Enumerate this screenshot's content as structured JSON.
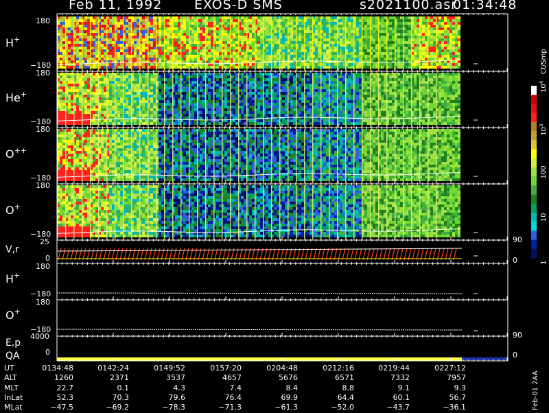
{
  "header": {
    "date": "Feb 11, 1992",
    "mission": "EXOS-D SMS",
    "file": "s2021100.asr",
    "time": "01:34:48"
  },
  "colors": {
    "background": "#000000",
    "axis": "#ffffff",
    "qa_bar": "#ffff44",
    "qa_bar_end": "#2233aa",
    "trace": "#ffffff",
    "velocity_ticks": "#ff4422"
  },
  "panels": {
    "h_plus": {
      "label": "H",
      "sup": "+",
      "ymax": "180",
      "ymin": "−180"
    },
    "he_plus": {
      "label": "He",
      "sup": "+",
      "ymax": "180",
      "ymin": "−180"
    },
    "o_pp": {
      "label": "O",
      "sup": "++",
      "ymax": "180",
      "ymin": "−180"
    },
    "o_plus": {
      "label": "O",
      "sup": "+",
      "ymax": "180",
      "ymin": "−180"
    },
    "vr": {
      "label": "V,r",
      "ymax": "25",
      "ymin": "0",
      "right_top": "90",
      "right_bottom": "0"
    },
    "h_plus2": {
      "label": "H",
      "sup": "+",
      "ymax": "180",
      "ymin": "−180"
    },
    "o_plus2": {
      "label": "O",
      "sup": "+",
      "ymax": "180",
      "ymin": "−180"
    },
    "ep": {
      "label": "E,p",
      "ymax": "4000",
      "ymin": "0",
      "right_top": "90",
      "right_bottom": "0"
    },
    "qa": {
      "label": "QA"
    }
  },
  "colorbar": {
    "unit": "Ct/Smp",
    "ticks": [
      {
        "label": "10",
        "sup": "4",
        "frac": 1.0
      },
      {
        "label": "10",
        "sup": "3",
        "frac": 0.75
      },
      {
        "label": "100",
        "sup": "",
        "frac": 0.5
      },
      {
        "label": "10",
        "sup": "",
        "frac": 0.25
      },
      {
        "label": "1",
        "sup": "",
        "frac": 0.0
      }
    ],
    "colors": [
      "#ffffff",
      "#cc0000",
      "#e41010",
      "#ff2020",
      "#b0802a",
      "#c2a030",
      "#d8c838",
      "#ffff00",
      "#d0f040",
      "#a0e040",
      "#70d830",
      "#40b040",
      "#208020",
      "#00a060",
      "#00b8b8",
      "#00d8d8",
      "#3060e0",
      "#0020a0",
      "#001060"
    ]
  },
  "table": {
    "row_labels": [
      "UT",
      "ALT",
      "MLT",
      "InLat",
      "MLat"
    ],
    "columns": [
      {
        "ut": "0134:48",
        "alt": "1260",
        "mlt": "22.7",
        "inlat": "52.3",
        "mlat": "−47.5"
      },
      {
        "ut": "0142:24",
        "alt": "2371",
        "mlt": "0.1",
        "inlat": "70.3",
        "mlat": "−69.2"
      },
      {
        "ut": "0149:52",
        "alt": "3537",
        "mlt": "4.3",
        "inlat": "79.6",
        "mlat": "−78.3"
      },
      {
        "ut": "0157:20",
        "alt": "4657",
        "mlt": "7.4",
        "inlat": "76.4",
        "mlat": "−71.3"
      },
      {
        "ut": "0204:48",
        "alt": "5676",
        "mlt": "8.4",
        "inlat": "69.9",
        "mlat": "−61.3"
      },
      {
        "ut": "0212:16",
        "alt": "6571",
        "mlt": "8.8",
        "inlat": "64.4",
        "mlat": "−52.0"
      },
      {
        "ut": "0219:44",
        "alt": "7332",
        "mlt": "9.1",
        "inlat": "60.1",
        "mlat": "−43.7"
      },
      {
        "ut": "0227:12",
        "alt": "7957",
        "mlt": "9.3",
        "inlat": "56.7",
        "mlat": "−36.1"
      }
    ],
    "stamp": "Feb-01 2AA"
  },
  "chart_data": {
    "type": "heatmap",
    "title": "Feb 11, 1992   EXOS-D SMS",
    "x_tick_labels": [
      "0134:48",
      "0142:24",
      "0149:52",
      "0157:20",
      "0204:48",
      "0212:16",
      "0219:44",
      "0227:12"
    ],
    "panels": [
      {
        "name": "H+",
        "ylim": [
          -180,
          180
        ],
        "dominant_color_by_segment": [
          "red/yellow",
          "red/yellow",
          "yellow/green",
          "yellow/green",
          "green",
          "green",
          "green",
          "yellow/green"
        ]
      },
      {
        "name": "He+",
        "ylim": [
          -180,
          180
        ],
        "dominant_color_by_segment": [
          "yellow/red",
          "green",
          "blue",
          "blue",
          "blue",
          "blue/cyan",
          "green",
          "green"
        ]
      },
      {
        "name": "O++",
        "ylim": [
          -180,
          180
        ],
        "dominant_color_by_segment": [
          "yellow/red",
          "green",
          "blue",
          "blue",
          "blue",
          "blue/cyan",
          "green",
          "green"
        ]
      },
      {
        "name": "O+",
        "ylim": [
          -180,
          180
        ],
        "dominant_color_by_segment": [
          "yellow/red",
          "green",
          "blue",
          "blue",
          "blue",
          "blue/cyan",
          "green",
          "green"
        ]
      }
    ],
    "line_panels": [
      {
        "name": "V,r",
        "ylim": [
          0,
          25
        ],
        "right_ylim": [
          0,
          90
        ]
      },
      {
        "name": "H+",
        "ylim": [
          -180,
          180
        ]
      },
      {
        "name": "O+",
        "ylim": [
          -180,
          180
        ]
      },
      {
        "name": "E,p",
        "ylim": [
          0,
          4000
        ],
        "right_ylim": [
          0,
          90
        ]
      }
    ],
    "colorbar_scale": "log",
    "colorbar_range": [
      1,
      10000
    ]
  }
}
